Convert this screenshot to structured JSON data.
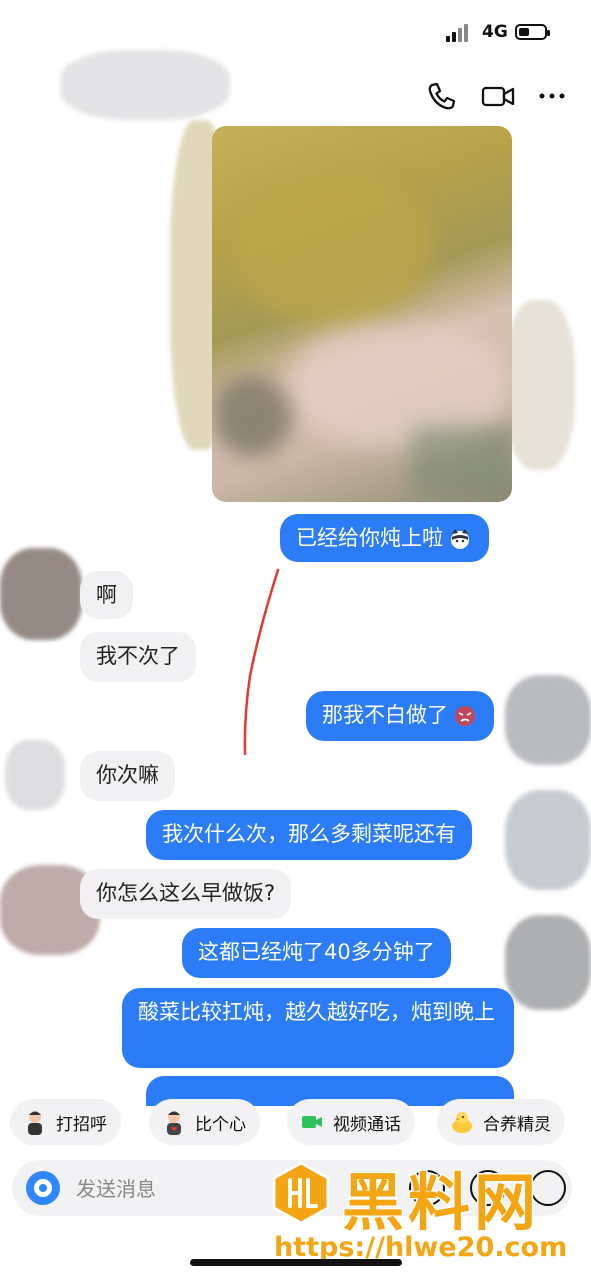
{
  "status_bar": {
    "network": "4G"
  },
  "header": {
    "icons": [
      "phone-icon",
      "video-call-icon",
      "more-icon"
    ]
  },
  "messages": [
    {
      "side": "me",
      "type": "image"
    },
    {
      "side": "me",
      "text": "已经给你炖上啦",
      "emoji": "cat-emoji"
    },
    {
      "side": "them",
      "text": "啊"
    },
    {
      "side": "them",
      "text": "我不次了"
    },
    {
      "side": "me",
      "text": "那我不白做了",
      "emoji": "angry-emoji"
    },
    {
      "side": "them",
      "text": "你次嘛"
    },
    {
      "side": "me",
      "text": "我次什么次，那么多剩菜呢还有"
    },
    {
      "side": "them",
      "text": "你怎么这么早做饭?"
    },
    {
      "side": "me",
      "text": "这都已经炖了40多分钟了"
    },
    {
      "side": "me",
      "text": "酸菜比较扛炖，越久越好吃，炖到晚上"
    }
  ],
  "quick_actions": [
    {
      "label": "打招呼",
      "icon": "avatar-sticker-icon"
    },
    {
      "label": "比个心",
      "icon": "heart-sticker-icon"
    },
    {
      "label": "视频通话",
      "icon": "video-icon",
      "color": "#2fc25b"
    },
    {
      "label": "合养精灵",
      "icon": "duck-icon"
    }
  ],
  "input": {
    "placeholder": "发送消息"
  },
  "watermark": {
    "title": "黑料网",
    "url": "https://hlwe20.com"
  },
  "colors": {
    "my_bubble": "#2b7cf6",
    "their_bubble": "#f1f1f3",
    "accent": "#2f87ff",
    "watermark": "#f3a513"
  }
}
